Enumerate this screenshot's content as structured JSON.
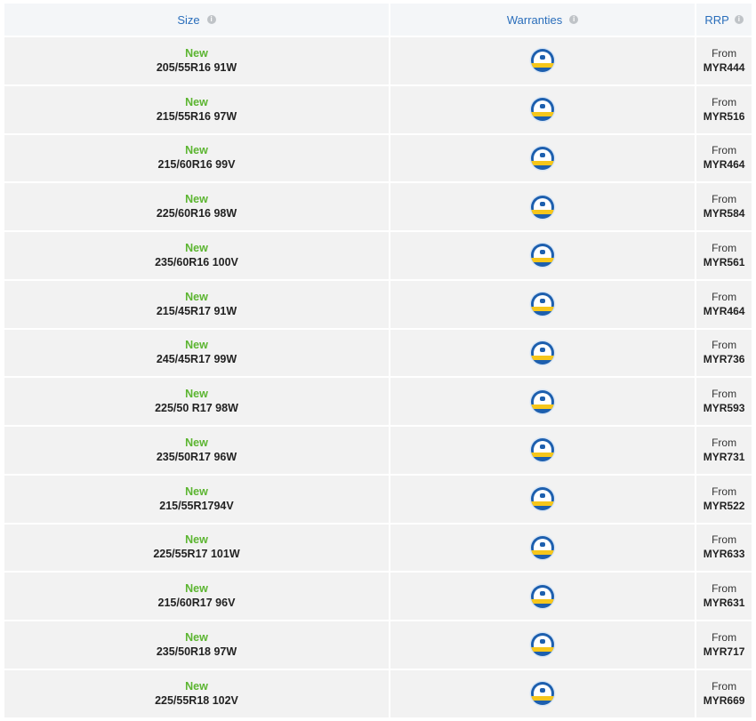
{
  "header": {
    "size_label": "Size",
    "warranties_label": "Warranties",
    "rrp_label": "RRP",
    "info_glyph": "i"
  },
  "rows": [
    {
      "status": "New",
      "size": "205/55R16 91W",
      "from": "From",
      "price": "MYR444"
    },
    {
      "status": "New",
      "size": "215/55R16 97W",
      "from": "From",
      "price": "MYR516"
    },
    {
      "status": "New",
      "size": "215/60R16 99V",
      "from": "From",
      "price": "MYR464"
    },
    {
      "status": "New",
      "size": "225/60R16 98W",
      "from": "From",
      "price": "MYR584"
    },
    {
      "status": "New",
      "size": "235/60R16 100V",
      "from": "From",
      "price": "MYR561"
    },
    {
      "status": "New",
      "size": "215/45R17 91W",
      "from": "From",
      "price": "MYR464"
    },
    {
      "status": "New",
      "size": "245/45R17 99W",
      "from": "From",
      "price": "MYR736"
    },
    {
      "status": "New",
      "size": "225/50 R17 98W",
      "from": "From",
      "price": "MYR593"
    },
    {
      "status": "New",
      "size": "235/50R17 96W",
      "from": "From",
      "price": "MYR731"
    },
    {
      "status": "New",
      "size": "215/55R1794V",
      "from": "From",
      "price": "MYR522"
    },
    {
      "status": "New",
      "size": "225/55R17 101W",
      "from": "From",
      "price": "MYR633"
    },
    {
      "status": "New",
      "size": "215/60R17 96V",
      "from": "From",
      "price": "MYR631"
    },
    {
      "status": "New",
      "size": "235/50R18 97W",
      "from": "From",
      "price": "MYR717"
    },
    {
      "status": "New",
      "size": "225/55R18 102V",
      "from": "From",
      "price": "MYR669"
    }
  ],
  "icons": {
    "warranty": "warranty-badge-icon",
    "info": "info-icon"
  },
  "colors": {
    "header_text": "#2a6ebb",
    "new_label": "#5cb531",
    "badge": "#1d5fae"
  }
}
